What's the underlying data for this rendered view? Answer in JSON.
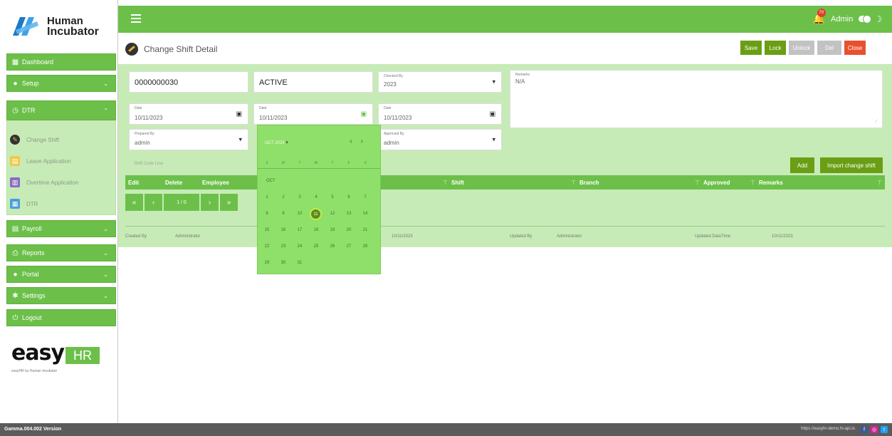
{
  "brand": {
    "line1": "Human",
    "line2": "Incubator"
  },
  "sidebar": {
    "items": [
      {
        "label": "Dashboard"
      },
      {
        "label": "Setup"
      },
      {
        "label": "DTR"
      },
      {
        "label": "Payroll"
      },
      {
        "label": "Reports"
      },
      {
        "label": "Portal"
      },
      {
        "label": "Settings"
      },
      {
        "label": "Logout"
      }
    ],
    "dtr_sub": [
      {
        "label": "Change Shift"
      },
      {
        "label": "Leave Application"
      },
      {
        "label": "Overtime Application"
      },
      {
        "label": "DTR"
      }
    ],
    "footer_logo": {
      "text1": "easy",
      "text2": "HR",
      "tagline": "easyHR by Human Incubator"
    }
  },
  "topbar": {
    "notif_count": "70",
    "user": "Admin"
  },
  "page": {
    "title": "Change Shift Detail"
  },
  "actions": {
    "save": "Save",
    "lock": "Lock",
    "unlock": "Unlock",
    "delete": "Del",
    "close": "Close"
  },
  "form": {
    "doc_no": "0000000030",
    "status": "ACTIVE",
    "checked_by": {
      "label": "Checked By",
      "value": "2023"
    },
    "remarks": {
      "label": "Remarks",
      "value": "N/A"
    },
    "date1": {
      "label": "Date",
      "value": "10/11/2023"
    },
    "date2": {
      "label": "Date",
      "value": "10/11/2023"
    },
    "date3": {
      "label": "Date",
      "value": "10/11/2023"
    },
    "prepared_by": {
      "label": "Prepared By",
      "value": "admin"
    },
    "approved_by": {
      "label": "Approved By",
      "value": "admin"
    }
  },
  "shift_code_line": "Shift Code Line",
  "grid_buttons": {
    "add": "Add",
    "import": "Import change shift"
  },
  "grid": {
    "columns": [
      "Edit",
      "Delete",
      "Employee",
      "Shift",
      "Branch",
      "Approved",
      "Remarks"
    ]
  },
  "pager": {
    "first": "«",
    "prev": "‹",
    "page": "1 / 0",
    "next": "›",
    "last": "»"
  },
  "audit": {
    "created_by_label": "Created By",
    "created_by": "Administrator",
    "created_date": "10/11/2023",
    "updated_by_label": "Updated By",
    "updated_by": "Administrator",
    "updated_dt_label": "Updated DateTime",
    "updated_dt": "10/11/2023"
  },
  "calendar": {
    "header": "OCT 2023",
    "dow": [
      "S",
      "M",
      "T",
      "W",
      "T",
      "F",
      "S"
    ],
    "month": "OCT",
    "selected": "11"
  },
  "footer": {
    "version": "Gamma.004.002 Version",
    "url": "https://easyhr-demo.hi-api.io"
  }
}
